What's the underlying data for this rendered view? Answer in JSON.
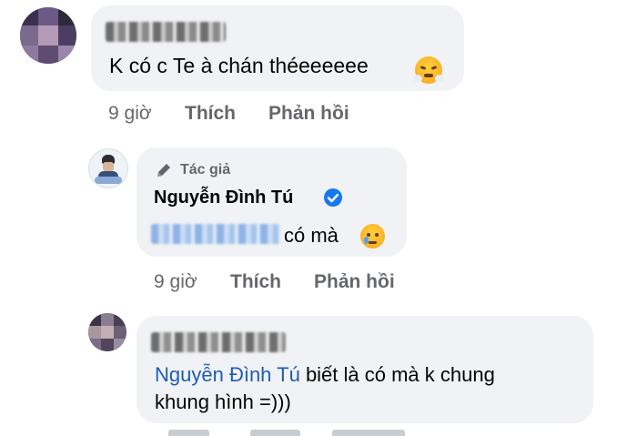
{
  "comments": [
    {
      "text": "K có c Te à chán théeeeeee",
      "time": "9 giờ",
      "like": "Thích",
      "reply": "Phản hồi"
    },
    {
      "author_badge": "Tác giả",
      "author": "Nguyễn Đình Tú",
      "text": "có mà",
      "time": "9 giờ",
      "like": "Thích",
      "reply": "Phản hồi"
    },
    {
      "mention": "Nguyễn Đình Tú",
      "text_line1": "biết là có mà k chung",
      "text_line2": "khung hình =)))"
    }
  ],
  "colors": {
    "bubble": "#f0f2f5",
    "meta": "#65676b",
    "mention": "#1f5cb4",
    "verified": "#1877f2"
  },
  "icons": [
    "pencil-icon",
    "verified-badge-icon",
    "steam-from-nose-emoji",
    "crying-face-emoji"
  ]
}
